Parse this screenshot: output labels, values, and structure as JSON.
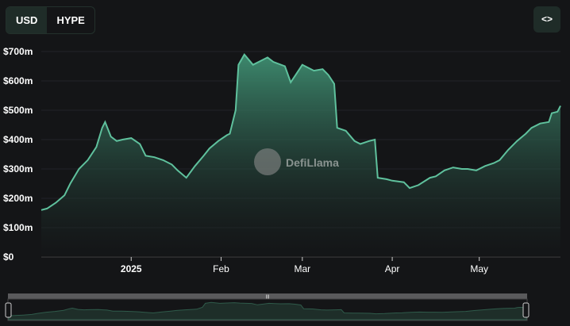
{
  "toggle": {
    "options": [
      "USD",
      "HYPE"
    ],
    "active": "USD"
  },
  "embed_button": {
    "icon": "code-brackets-icon",
    "label": "<>"
  },
  "watermark": "DefiLlama",
  "colors": {
    "line": "#5fc19d",
    "fill_top": "#3f8f72",
    "fill_bottom": "#141517",
    "grid": "#222428"
  },
  "chart_data": {
    "type": "area",
    "title": "",
    "xlabel": "",
    "ylabel": "",
    "x_unit": "days since 2024-12-01",
    "xlim": [
      0,
      179
    ],
    "ylim": [
      0,
      700
    ],
    "y_unit": "$m",
    "yticks": [
      {
        "v": 0,
        "label": "$0"
      },
      {
        "v": 100,
        "label": "$100m"
      },
      {
        "v": 200,
        "label": "$200m"
      },
      {
        "v": 300,
        "label": "$300m"
      },
      {
        "v": 400,
        "label": "$400m"
      },
      {
        "v": 500,
        "label": "$500m"
      },
      {
        "v": 600,
        "label": "$600m"
      },
      {
        "v": 700,
        "label": "$700m"
      }
    ],
    "xticks": [
      {
        "v": 31,
        "label": "2025",
        "bold": true
      },
      {
        "v": 62,
        "label": "Feb"
      },
      {
        "v": 90,
        "label": "Mar"
      },
      {
        "v": 121,
        "label": "Apr"
      },
      {
        "v": 151,
        "label": "May"
      }
    ],
    "grid": true,
    "points": [
      [
        0,
        160
      ],
      [
        2,
        165
      ],
      [
        5,
        185
      ],
      [
        8,
        210
      ],
      [
        10,
        250
      ],
      [
        13,
        300
      ],
      [
        16,
        330
      ],
      [
        19,
        375
      ],
      [
        21,
        440
      ],
      [
        22,
        460
      ],
      [
        24,
        410
      ],
      [
        26,
        395
      ],
      [
        28,
        400
      ],
      [
        31,
        405
      ],
      [
        34,
        385
      ],
      [
        36,
        345
      ],
      [
        39,
        340
      ],
      [
        42,
        330
      ],
      [
        45,
        315
      ],
      [
        47,
        295
      ],
      [
        50,
        270
      ],
      [
        53,
        310
      ],
      [
        56,
        345
      ],
      [
        58,
        370
      ],
      [
        61,
        395
      ],
      [
        64,
        415
      ],
      [
        65,
        420
      ],
      [
        67,
        500
      ],
      [
        68,
        655
      ],
      [
        70,
        690
      ],
      [
        73,
        655
      ],
      [
        78,
        680
      ],
      [
        80,
        665
      ],
      [
        84,
        650
      ],
      [
        86,
        595
      ],
      [
        88,
        625
      ],
      [
        90,
        655
      ],
      [
        92,
        645
      ],
      [
        94,
        635
      ],
      [
        97,
        640
      ],
      [
        99,
        620
      ],
      [
        101,
        590
      ],
      [
        102,
        440
      ],
      [
        105,
        430
      ],
      [
        108,
        395
      ],
      [
        110,
        385
      ],
      [
        113,
        395
      ],
      [
        115,
        400
      ],
      [
        116,
        270
      ],
      [
        119,
        265
      ],
      [
        121,
        260
      ],
      [
        125,
        255
      ],
      [
        127,
        235
      ],
      [
        130,
        245
      ],
      [
        134,
        270
      ],
      [
        136,
        275
      ],
      [
        139,
        295
      ],
      [
        142,
        305
      ],
      [
        145,
        300
      ],
      [
        147,
        300
      ],
      [
        150,
        295
      ],
      [
        153,
        310
      ],
      [
        156,
        320
      ],
      [
        158,
        330
      ],
      [
        161,
        365
      ],
      [
        164,
        395
      ],
      [
        167,
        420
      ],
      [
        169,
        440
      ],
      [
        172,
        455
      ],
      [
        175,
        460
      ],
      [
        176,
        490
      ],
      [
        178,
        495
      ],
      [
        179,
        515
      ]
    ]
  }
}
